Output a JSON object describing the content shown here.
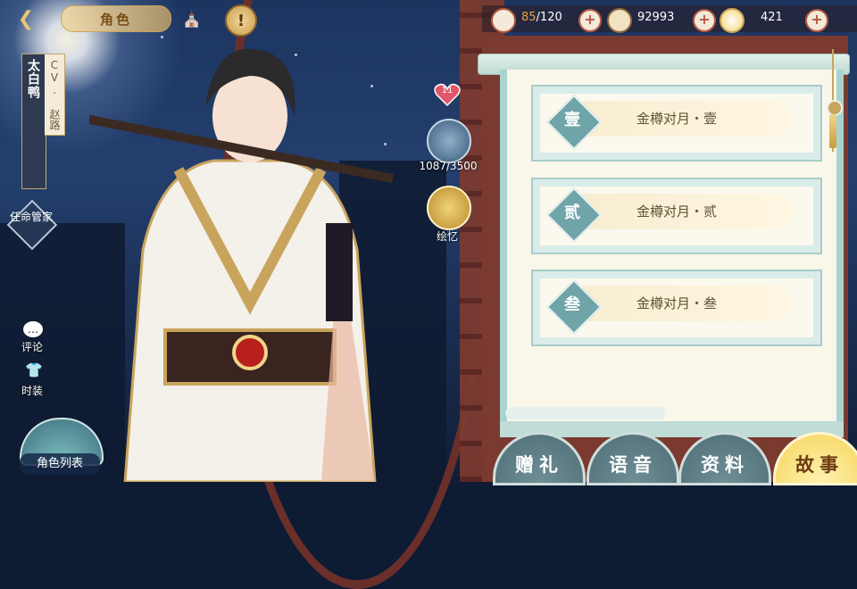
{
  "header": {
    "title": "角色",
    "back_icon": "back-arrow-icon",
    "home_icon": "pavilion-icon",
    "alert_icon": "exclamation-icon"
  },
  "character": {
    "name": "太白鸭",
    "cv": "CV. 赵路",
    "affection": "11",
    "bond_progress": "1087/3500",
    "memory_label": "绘忆"
  },
  "left_menu": {
    "assign_manager": "任命管家",
    "comment": "评论",
    "costume": "时装",
    "character_list": "角色列表"
  },
  "resources": [
    {
      "icon": "bowl-icon",
      "current": "85",
      "max": "/120",
      "color": "#e8a23a"
    },
    {
      "icon": "feather-icon",
      "value": "92993"
    },
    {
      "icon": "coin-icon",
      "value": "421"
    }
  ],
  "stories": [
    {
      "badge": "壹",
      "title": "金樽对月・壹"
    },
    {
      "badge": "贰",
      "title": "金樽对月・贰"
    },
    {
      "badge": "叁",
      "title": "金樽对月・叁"
    }
  ],
  "tabs": [
    {
      "label": "赠礼",
      "active": false
    },
    {
      "label": "语音",
      "active": false
    },
    {
      "label": "资料",
      "active": false
    },
    {
      "label": "故事",
      "active": true
    }
  ],
  "colors": {
    "accent_gold": "#f6d45a",
    "frame_red": "#7a3a30",
    "panel_teal": "#a9d3cf"
  }
}
